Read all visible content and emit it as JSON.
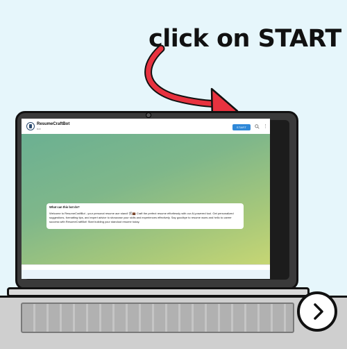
{
  "headline": {
    "text": "click on START"
  },
  "bot": {
    "name": "ResumeCraftBot",
    "subtitle": "bot"
  },
  "header": {
    "start_label": "START"
  },
  "message": {
    "title": "What can this bot do?",
    "body": "Welcome to ResumeCraftBot - your personal resume ace stand! 🛠💼 Craft the perfect resume effortlessly with our AI-powered tool. Get personalized suggestions, formatting tips, and expert advice to showcase your skills and experiences effectively. Say goodbye to resume woes and hello to career success with ResumeCraftBot! Start building your standout resume today."
  },
  "colors": {
    "arrow": "#e8323f",
    "start_button": "#2f88d8",
    "background": "#e6f6fb"
  },
  "icons": [
    "search-icon",
    "more-vertical-icon",
    "chevron-right-icon"
  ]
}
